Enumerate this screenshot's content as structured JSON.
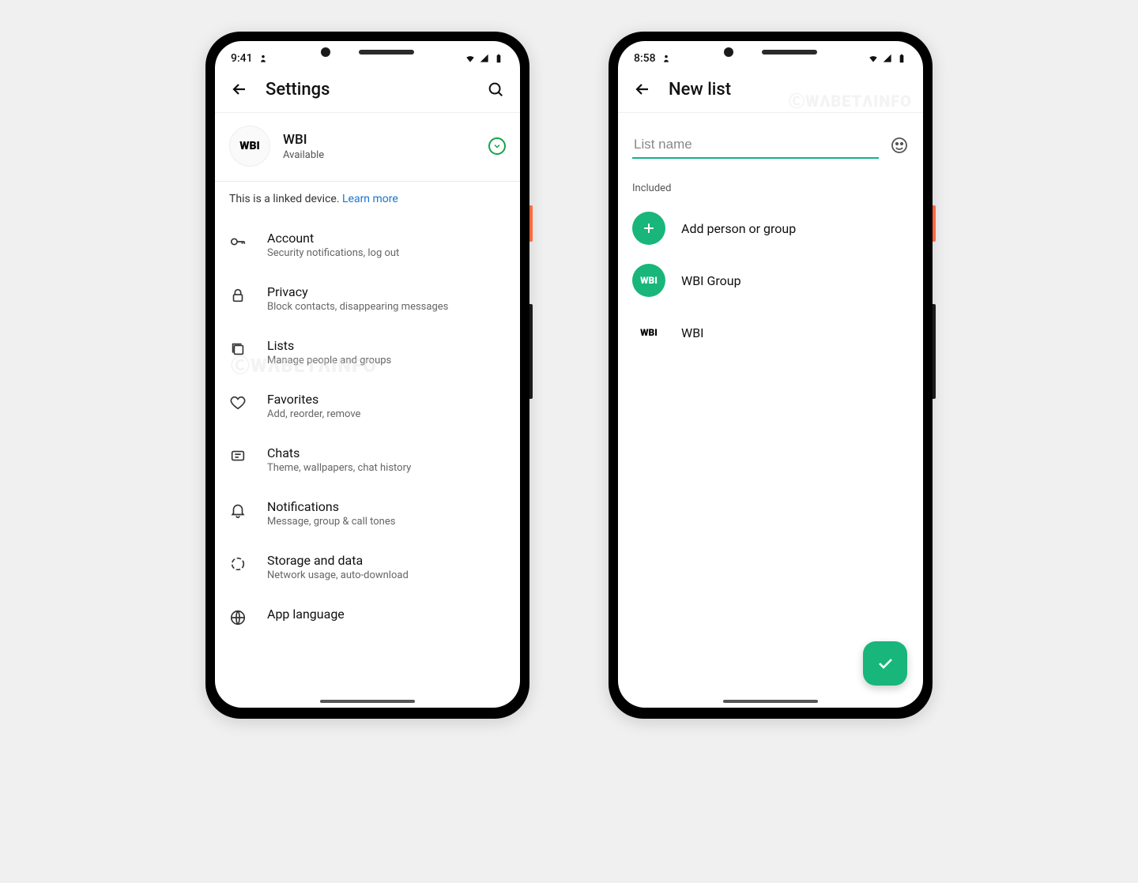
{
  "leftPhone": {
    "statusTime": "9:41",
    "title": "Settings",
    "profile": {
      "name": "WBI",
      "status": "Available"
    },
    "linkedDevice": {
      "text": "This is a linked device. ",
      "link": "Learn more"
    },
    "items": [
      {
        "icon": "key",
        "title": "Account",
        "sub": "Security notifications, log out"
      },
      {
        "icon": "lock",
        "title": "Privacy",
        "sub": "Block contacts, disappearing messages"
      },
      {
        "icon": "lists",
        "title": "Lists",
        "sub": "Manage people and groups"
      },
      {
        "icon": "heart",
        "title": "Favorites",
        "sub": "Add, reorder, remove"
      },
      {
        "icon": "chat",
        "title": "Chats",
        "sub": "Theme, wallpapers, chat history"
      },
      {
        "icon": "bell",
        "title": "Notifications",
        "sub": "Message, group & call tones"
      },
      {
        "icon": "storage",
        "title": "Storage and data",
        "sub": "Network usage, auto-download"
      },
      {
        "icon": "globe",
        "title": "App language",
        "sub": ""
      }
    ],
    "watermark": "ⒸWΛBETΛINFO"
  },
  "rightPhone": {
    "statusTime": "8:58",
    "title": "New list",
    "inputPlaceholder": "List name",
    "sectionLabel": "Included",
    "addLabel": "Add person or group",
    "items": [
      {
        "type": "group",
        "label": "WBI Group"
      },
      {
        "type": "person",
        "label": "WBI"
      }
    ],
    "watermark": "ⒸWΛBETΛINFO"
  }
}
